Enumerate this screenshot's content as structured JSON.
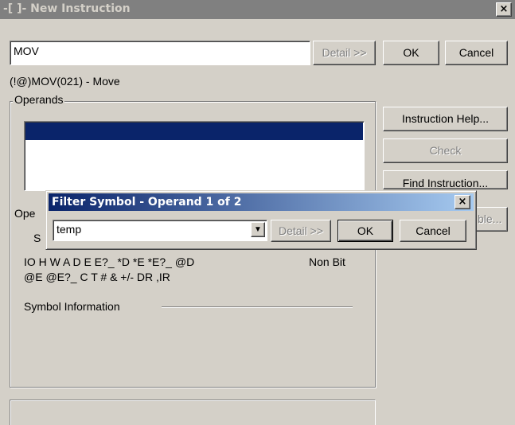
{
  "main_window": {
    "title": "-[ ]- New Instruction",
    "close_glyph": "×",
    "instruction_value": "MOV",
    "detail_button": "Detail >>",
    "ok_button": "OK",
    "cancel_button": "Cancel",
    "instruction_desc": "(!@)MOV(021) - Move",
    "operands_legend": "Operands",
    "instruction_help_button": "Instruction Help...",
    "check_button": "Check",
    "find_instruction_button": "Find Instruction...",
    "partial_button_text": "ble...",
    "partial_operand_label": "Ope",
    "partial_s_label": "S",
    "operand_types_line1": "IO H W A D E E?_ *D *E *E?_ @D",
    "operand_types_line2": "@E @E?_ C T # & +/- DR ,IR",
    "non_bit_label": "Non Bit",
    "symbol_info_label": "Symbol Information"
  },
  "filter_dialog": {
    "title": "Filter Symbol - Operand 1 of 2",
    "close_glyph": "×",
    "combo_value": "temp",
    "dropdown_glyph": "▼",
    "detail_button": "Detail >>",
    "ok_button": "OK",
    "cancel_button": "Cancel"
  },
  "colors": {
    "title_inactive": "#808080",
    "title_active": "#0a246a",
    "selection": "#0a246a",
    "face": "#d4d0c8"
  }
}
